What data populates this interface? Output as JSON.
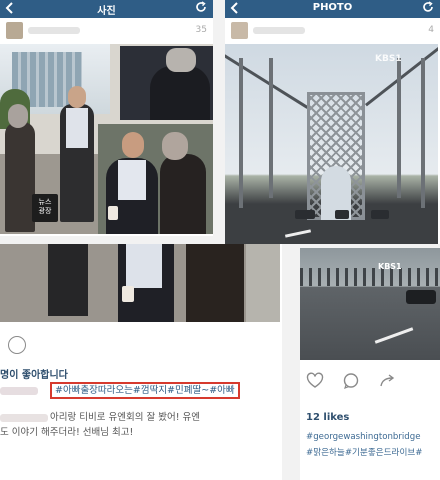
{
  "left_post": {
    "header_title": "사진",
    "timestamp": "35",
    "news_logo": "뉴스\n광장",
    "likes_line": "명이 좋아합니다",
    "hashtags": "#아빠출장따라오는#껌딱지#민폐딸~#아빠",
    "comment_line1": "아리랑 티비로 유엔회의 잘 봤어! 유엔",
    "comment_line2": "도 이야기 해주더라! 선배님 최고!"
  },
  "right_post": {
    "header_title": "PHOTO",
    "timestamp": "4",
    "watermark": "KBS1",
    "likes_count": "12 likes",
    "tags_line1": "#georgewashingtonbridge",
    "tags_line2": "#맑은하늘#기분좋은드라이브#"
  },
  "icons": {
    "back": "chevron-left-icon",
    "refresh": "refresh-icon",
    "comment": "comment-icon",
    "like": "heart-icon",
    "share": "share-icon"
  },
  "colors": {
    "header_bar": "#2f5d86",
    "hashtag_box": "#d63a2e",
    "hashtag_text": "#2f5d86"
  }
}
